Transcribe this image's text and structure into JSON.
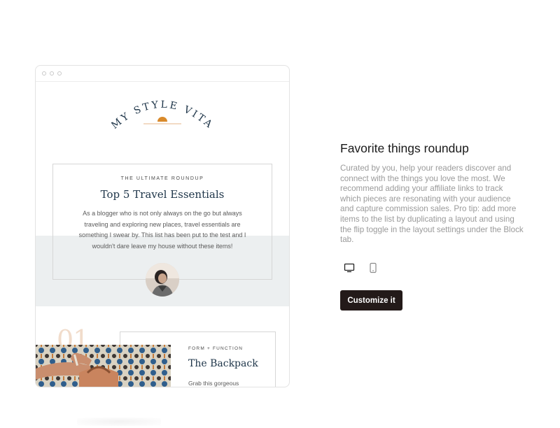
{
  "preview": {
    "logo_text": "MY STYLE VITA",
    "roundup": {
      "eyebrow": "The Ultimate Roundup",
      "title": "Top 5 Travel Essentials",
      "body": "As a blogger who is not only always on the go but always traveling and exploring new places, travel essentials are something I swear by. This list has been put to the test and I wouldn't dare leave my house without these items!"
    },
    "item": {
      "number": "01",
      "eyebrow": "Form + Function",
      "title": "The Backpack",
      "body": "Grab this gorgeous"
    },
    "accent_color": "#1d3448",
    "sun_color": "#d98a2b"
  },
  "panel": {
    "heading": "Favorite things roundup",
    "description": "Curated by you, help your readers discover and connect with the things you love the most. We recommend adding your affiliate links to track which pieces are resonating with your audience and capture commission sales. Pro tip: add more items to the list by duplicating a layout and using the flip toggle in the layout settings under the Block tab.",
    "toggles": [
      {
        "icon": "desktop-icon",
        "selected": true
      },
      {
        "icon": "mobile-icon",
        "selected": false
      }
    ],
    "cta_label": "Customize it",
    "cta_color": "#231a19"
  }
}
